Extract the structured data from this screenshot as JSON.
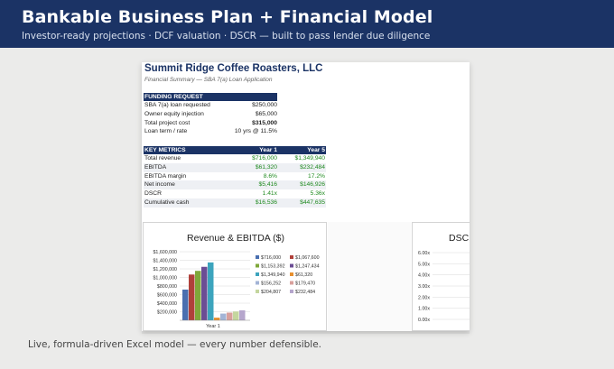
{
  "banner": {
    "title": "Bankable Business Plan  +  Financial Model",
    "subtitle": "Investor-ready projections · DCF valuation · DSCR — built to pass lender due diligence"
  },
  "sheet": {
    "company": "Summit Ridge Coffee Roasters, LLC",
    "subtitle": "Financial Summary — SBA 7(a) Loan Application",
    "funding": {
      "header": "FUNDING REQUEST",
      "rows": [
        {
          "label": "SBA 7(a) loan requested",
          "value": "$250,000",
          "bold": false
        },
        {
          "label": "Owner equity injection",
          "value": "$65,000",
          "bold": false
        },
        {
          "label": "Total project cost",
          "value": "$315,000",
          "bold": true
        },
        {
          "label": "Loan term / rate",
          "value": "10 yrs @ 11.5%",
          "bold": false
        }
      ]
    },
    "metrics": {
      "header": "KEY METRICS",
      "col1": "Year 1",
      "col2": "Year 5",
      "rows": [
        {
          "label": "Total revenue",
          "y1": "$716,000",
          "y5": "$1,349,940"
        },
        {
          "label": "EBITDA",
          "y1": "$61,320",
          "y5": "$232,484"
        },
        {
          "label": "EBITDA margin",
          "y1": "8.6%",
          "y5": "17.2%"
        },
        {
          "label": "Net income",
          "y1": "$5,416",
          "y5": "$146,926"
        },
        {
          "label": "DSCR",
          "y1": "1.41x",
          "y5": "5.36x"
        },
        {
          "label": "Cumulative cash",
          "y1": "$16,536",
          "y5": "$447,635"
        }
      ]
    }
  },
  "caption": "Live, formula-driven Excel model — every number defensible.",
  "chart_data": [
    {
      "type": "bar",
      "title": "Revenue & EBITDA ($)",
      "categories": [
        "Year 1"
      ],
      "y_ticks": [
        "$1,600,000",
        "$1,400,000",
        "$1,200,000",
        "$1,000,000",
        "$800,000",
        "$600,000",
        "$400,000",
        "$200,000"
      ],
      "ylim": [
        0,
        1600000
      ],
      "bars": [
        {
          "label": "$716,000",
          "value": 716000,
          "color": "#4a6fb0"
        },
        {
          "label": "$1,067,600",
          "value": 1067600,
          "color": "#b0403a"
        },
        {
          "label": "$1,153,392",
          "value": 1153392,
          "color": "#7fa83a"
        },
        {
          "label": "$1,247,434",
          "value": 1247434,
          "color": "#6b4d94"
        },
        {
          "label": "$1,349,940",
          "value": 1349940,
          "color": "#3ca4bd"
        },
        {
          "label": "$61,320",
          "value": 61320,
          "color": "#e8902f"
        },
        {
          "label": "$156,252",
          "value": 156252,
          "color": "#a3b4d6"
        },
        {
          "label": "$179,470",
          "value": 179470,
          "color": "#d9a09c"
        },
        {
          "label": "$204,807",
          "value": 204807,
          "color": "#c4d69e"
        },
        {
          "label": "$232,484",
          "value": 232484,
          "color": "#b5a6cc"
        }
      ],
      "legend_placement": "right",
      "grid": true
    },
    {
      "type": "line",
      "title": "DSCR",
      "y_ticks": [
        "6.00x",
        "5.00x",
        "4.00x",
        "3.00x",
        "2.00x",
        "1.00x",
        "0.00x"
      ],
      "ylim": [
        0,
        6
      ],
      "grid": true
    }
  ]
}
